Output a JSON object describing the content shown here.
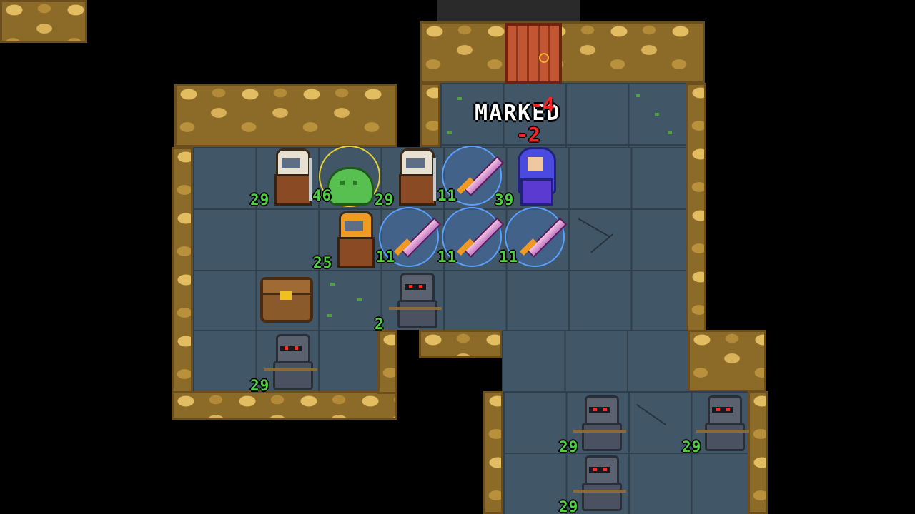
{
  "status_text": {
    "marked": "MARKED",
    "damage_a": "-4",
    "damage_b": "-2"
  },
  "units": {
    "hooded_1_hp": "29",
    "slime_hp": "46",
    "hooded_2_hp": "29",
    "sword_1_hp": "11",
    "mage_hp": "39",
    "orange_hooded_hp": "25",
    "sword_2_hp": "11",
    "sword_3_hp": "11",
    "sword_4_hp": "11",
    "knight_1_hp": "2",
    "knight_2_hp": "29",
    "knight_3_hp": "29",
    "knight_4_hp": "29",
    "knight_5_hp": "29"
  },
  "colors": {
    "hp_text": "#4fd040",
    "damage_text": "#ff2020",
    "wall": "#c9a24a",
    "floor": "#415667",
    "highlight_ring": "#e8d030"
  },
  "icons": [
    "door-icon",
    "chest-icon",
    "knight-icon",
    "hooded-cultist-icon",
    "slime-icon",
    "mage-icon",
    "sword-icon"
  ]
}
